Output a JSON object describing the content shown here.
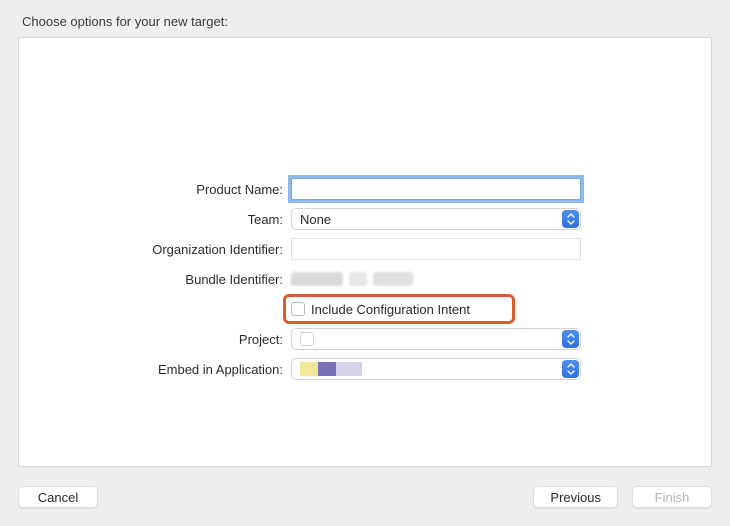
{
  "title": "Choose options for your new target:",
  "labels": {
    "product_name": "Product Name:",
    "team": "Team:",
    "org_id": "Organization Identifier:",
    "bundle_id": "Bundle Identifier:",
    "include_config": "Include Configuration Intent",
    "project": "Project:",
    "embed_app": "Embed in Application:"
  },
  "values": {
    "product_name": "",
    "team": "None",
    "org_id": "",
    "bundle_id": "",
    "include_config_checked": false,
    "project": "",
    "embed_app": ""
  },
  "buttons": {
    "cancel": "Cancel",
    "previous": "Previous",
    "finish": "Finish"
  },
  "colors": {
    "accent": "#3a7be8",
    "highlight": "#e05a2f"
  }
}
